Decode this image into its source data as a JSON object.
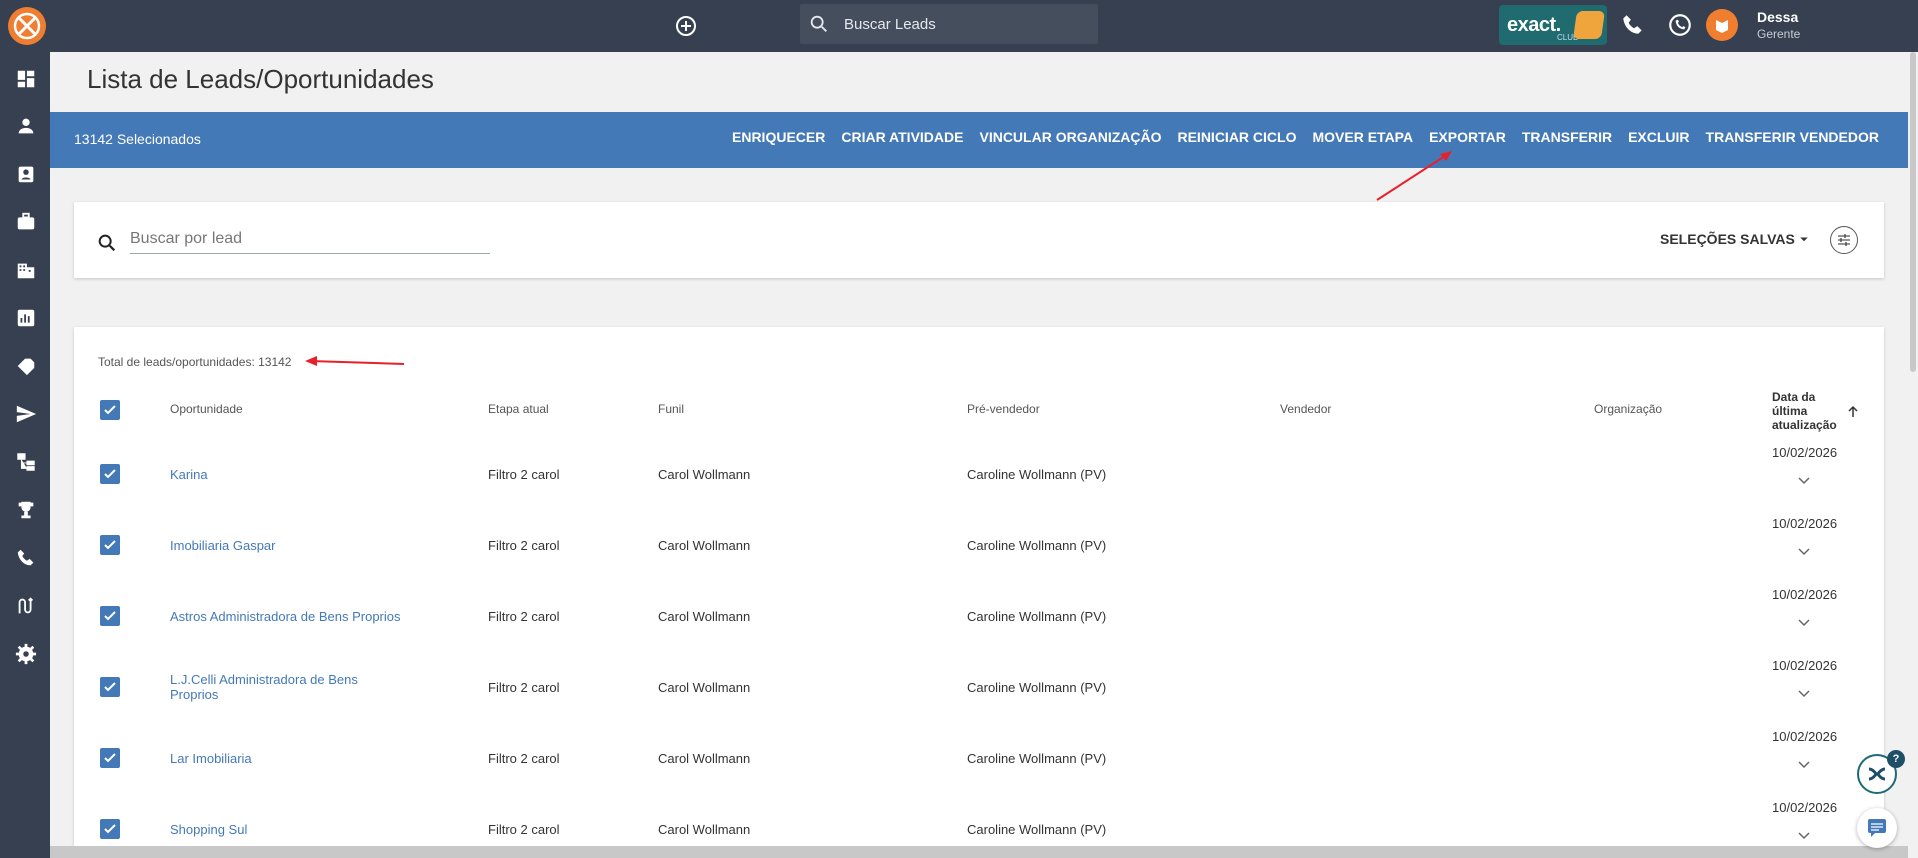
{
  "topbar": {
    "search_placeholder": "Buscar Leads",
    "brand_text": "exact.",
    "brand_sub": "CLUB",
    "user_name": "Dessa",
    "user_role": "Gerente"
  },
  "page": {
    "title": "Lista de Leads/Oportunidades"
  },
  "selection_bar": {
    "selected_label": "13142 Selecionados",
    "actions": [
      "ENRIQUECER",
      "CRIAR ATIVIDADE",
      "VINCULAR ORGANIZAÇÃO",
      "REINICIAR CICLO",
      "MOVER ETAPA",
      "EXPORTAR",
      "TRANSFERIR",
      "EXCLUIR",
      "TRANSFERIR VENDEDOR"
    ]
  },
  "search": {
    "placeholder": "Buscar por lead",
    "saved_label": "SELEÇÕES SALVAS"
  },
  "table": {
    "total_label": "Total de leads/oportunidades: 13142",
    "headers": {
      "oportunidade": "Oportunidade",
      "etapa": "Etapa atual",
      "funil": "Funil",
      "pre_vendedor": "Pré-vendedor",
      "vendedor": "Vendedor",
      "organizacao": "Organização",
      "data": "Data da última atualização"
    },
    "rows": [
      {
        "lead": "Karina",
        "etapa": "Filtro 2 carol",
        "funil": "Carol Wollmann",
        "pre": "Caroline Wollmann (PV)",
        "data": "10/02/2026"
      },
      {
        "lead": "Imobiliaria Gaspar",
        "etapa": "Filtro 2 carol",
        "funil": "Carol Wollmann",
        "pre": "Caroline Wollmann (PV)",
        "data": "10/02/2026"
      },
      {
        "lead": "Astros Administradora de Bens Proprios",
        "etapa": "Filtro 2 carol",
        "funil": "Carol Wollmann",
        "pre": "Caroline Wollmann (PV)",
        "data": "10/02/2026"
      },
      {
        "lead": "L.J.Celli Administradora de Bens Proprios",
        "etapa": "Filtro 2 carol",
        "funil": "Carol Wollmann",
        "pre": "Caroline Wollmann (PV)",
        "data": "10/02/2026"
      },
      {
        "lead": "Lar Imobiliaria",
        "etapa": "Filtro 2 carol",
        "funil": "Carol Wollmann",
        "pre": "Caroline Wollmann (PV)",
        "data": "10/02/2026"
      },
      {
        "lead": "Shopping Sul",
        "etapa": "Filtro 2 carol",
        "funil": "Carol Wollmann",
        "pre": "Caroline Wollmann (PV)",
        "data": "10/02/2026"
      }
    ]
  },
  "help_badge": "?",
  "colors": {
    "topbar": "#364050",
    "accent": "#4479b7",
    "orange": "#f07e31",
    "annotation": "#e8202a"
  }
}
